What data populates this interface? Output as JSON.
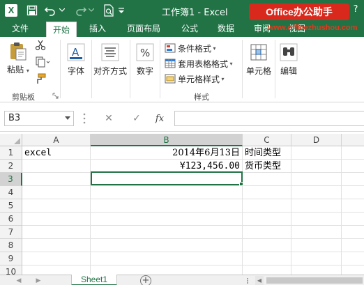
{
  "titlebar": {
    "title": "工作簿1 - Excel",
    "watermark": "Office办公助手",
    "help_label": "?",
    "app_icon_label": "X"
  },
  "ribbon_tabs": [
    {
      "label": "文件"
    },
    {
      "label": "开始"
    },
    {
      "label": "插入"
    },
    {
      "label": "页面布局"
    },
    {
      "label": "公式"
    },
    {
      "label": "数据"
    },
    {
      "label": "审阅"
    },
    {
      "label": "视图"
    }
  ],
  "url_watermark": "www.officezhushou.com",
  "ribbon": {
    "clipboard": {
      "paste": "粘贴",
      "group": "剪贴板"
    },
    "font": {
      "label": "字体"
    },
    "alignment": {
      "label": "对齐方式"
    },
    "number": {
      "label": "数字"
    },
    "styles": {
      "conditional": "条件格式",
      "table": "套用表格格式",
      "cell_styles": "单元格样式",
      "group": "样式"
    },
    "cells": {
      "label": "单元格"
    },
    "editing": {
      "label": "编辑"
    }
  },
  "formula_bar": {
    "name_box": "B3",
    "cancel": "✕",
    "enter": "✓",
    "fx": "fx",
    "value": ""
  },
  "grid": {
    "columns": [
      "A",
      "B",
      "C",
      "D"
    ],
    "rows": [
      "1",
      "2",
      "3",
      "4",
      "5",
      "6",
      "7",
      "8",
      "9",
      "10"
    ],
    "cells": {
      "A1": "excel",
      "B1": "2014年6月13日",
      "C1": "时间类型",
      "B2": "¥123,456.00",
      "C2": "货币类型"
    },
    "active_cell": "B3"
  },
  "sheets": {
    "tabs": [
      "Sheet1"
    ],
    "add": "+"
  },
  "colors": {
    "accent": "#217346",
    "watermark": "#d9291c"
  }
}
